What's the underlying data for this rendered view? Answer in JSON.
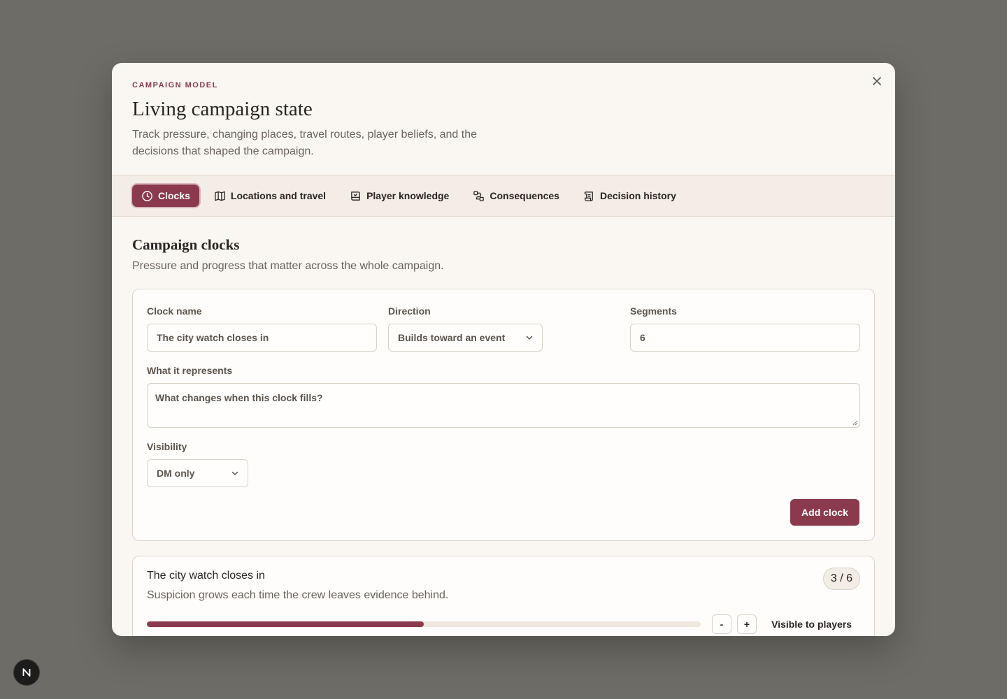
{
  "modal": {
    "eyebrow": "Campaign model",
    "title": "Living campaign state",
    "subtitle": "Track pressure, changing places, travel routes, player beliefs, and the decisions that shaped the campaign."
  },
  "tabs": [
    {
      "label": "Clocks",
      "icon": "clock-icon",
      "active": true
    },
    {
      "label": "Locations and travel",
      "icon": "map-icon"
    },
    {
      "label": "Player knowledge",
      "icon": "book-check-icon"
    },
    {
      "label": "Consequences",
      "icon": "route-icon"
    },
    {
      "label": "Decision history",
      "icon": "scroll-icon"
    }
  ],
  "section": {
    "title": "Campaign clocks",
    "subtitle": "Pressure and progress that matter across the whole campaign."
  },
  "form": {
    "clock_name_label": "Clock name",
    "clock_name_placeholder": "The city watch closes in",
    "direction_label": "Direction",
    "direction_value": "Builds toward an event",
    "segments_label": "Segments",
    "segments_value": "6",
    "represents_label": "What it represents",
    "represents_placeholder": "What changes when this clock fills?",
    "visibility_label": "Visibility",
    "visibility_value": "DM only",
    "add_button": "Add clock"
  },
  "clocks": [
    {
      "name": "The city watch closes in",
      "description": "Suspicion grows each time the crew leaves evidence behind.",
      "count_text": "3 / 6",
      "filled": 3,
      "segments": 6,
      "decrement_label": "-",
      "increment_label": "+",
      "visibility_label": "Visible to players"
    }
  ],
  "colors": {
    "accent": "#8a3a4c",
    "backdrop": "#6d6c66",
    "surface": "#faf7f2"
  },
  "fab": {
    "label": "N"
  }
}
